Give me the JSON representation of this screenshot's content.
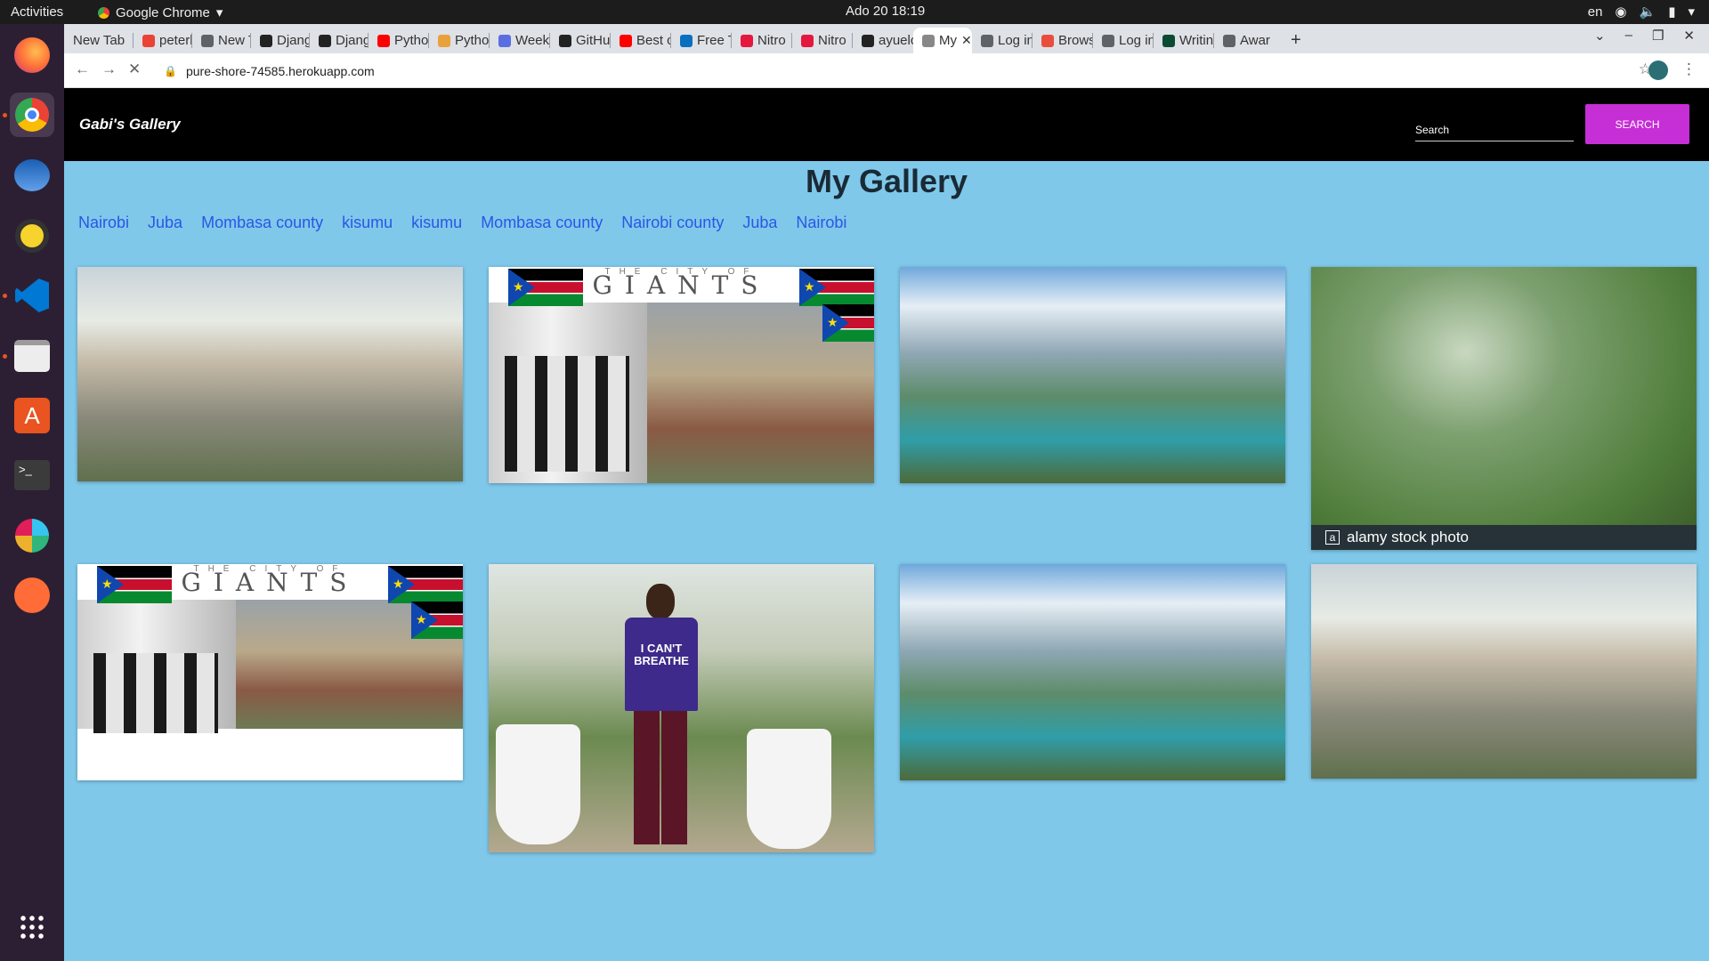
{
  "system": {
    "activities": "Activities",
    "app_name": "Google Chrome",
    "clock": "Ado 20  18:19",
    "language": "en"
  },
  "browser": {
    "tabs": [
      {
        "label": "New Tab",
        "color": "#5f6368"
      },
      {
        "label": "peterl",
        "color": "#ea4335"
      },
      {
        "label": "New Tab",
        "color": "#5f6368"
      },
      {
        "label": "Djang",
        "color": "#222222"
      },
      {
        "label": "Djang",
        "color": "#222222"
      },
      {
        "label": "Pytho",
        "color": "#ff0000"
      },
      {
        "label": "Pytho",
        "color": "#e9a23b"
      },
      {
        "label": "Week",
        "color": "#5b6ee1"
      },
      {
        "label": "GitHu",
        "color": "#222222"
      },
      {
        "label": "Best c",
        "color": "#ff0000"
      },
      {
        "label": "Free T",
        "color": "#0b6fbf"
      },
      {
        "label": "Nitro",
        "color": "#e5173f"
      },
      {
        "label": "Nitro",
        "color": "#e5173f"
      },
      {
        "label": "ayuelc",
        "color": "#222222"
      },
      {
        "label": "My",
        "color": "#888888",
        "active": true
      },
      {
        "label": "Log in",
        "color": "#5f6368"
      },
      {
        "label": "Brows",
        "color": "#e94e3c"
      },
      {
        "label": "Log in",
        "color": "#5f6368"
      },
      {
        "label": "Writin",
        "color": "#0c4b33"
      },
      {
        "label": "Awar",
        "color": "#5f6368"
      }
    ],
    "url": "pure-shore-74585.herokuapp.com"
  },
  "site": {
    "brand": "Gabi's Gallery",
    "search_placeholder": "Search",
    "search_button": "SEARCH",
    "title": "My Gallery",
    "locations": [
      "Nairobi",
      "Juba",
      "Mombasa county",
      "kisumu",
      "kisumu",
      "Mombasa county",
      "Nairobi county",
      "Juba",
      "Nairobi"
    ],
    "giants_top": "THE CITY OF",
    "giants_main": "GIANTS",
    "alamy": "alamy stock photo",
    "shirt": "I CAN'T BREATHE"
  }
}
